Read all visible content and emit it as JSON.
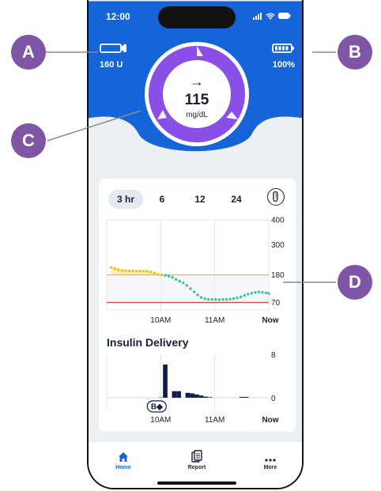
{
  "colors": {
    "brand_blue": "#1565d8",
    "ring_purple": "#8a4fe6",
    "callout_purple": "#7f56a6",
    "target_line": "#f2b124",
    "low_line": "#e0443a",
    "high_dots": "#f2c100",
    "in_range_dots": "#3ec39a",
    "bar": "#0c1f4f"
  },
  "status_bar": {
    "time": "12:00"
  },
  "pod": {
    "insulin_label": "160 U",
    "icon": "insulin-pod-icon"
  },
  "battery": {
    "label": "100%",
    "icon": "battery-icon"
  },
  "glucose": {
    "trend_arrow": "→",
    "value": "115",
    "unit": "mg/dL"
  },
  "time_tabs": [
    {
      "label": "3 hr",
      "selected": true
    },
    {
      "label": "6"
    },
    {
      "label": "12"
    },
    {
      "label": "24"
    }
  ],
  "cgm_chart": {
    "y_ticks": [
      "400",
      "300",
      "180",
      "70"
    ],
    "x_ticks": [
      "10AM",
      "11AM",
      "Now"
    ],
    "high_target": 180,
    "low_limit": 70
  },
  "insulin_delivery": {
    "title": "Insulin Delivery",
    "y_ticks": [
      "8",
      "0"
    ],
    "x_ticks": [
      "10AM",
      "11AM",
      "Now"
    ],
    "bolus_badge": "B◆"
  },
  "bottom_nav": [
    {
      "label": "Home",
      "icon": "home-icon"
    },
    {
      "label": "Report",
      "icon": "report-icon"
    },
    {
      "label": "More",
      "icon": "more-icon"
    }
  ],
  "callouts": [
    "A",
    "B",
    "C",
    "D"
  ],
  "chart_data": [
    {
      "type": "scatter",
      "title": "",
      "x": [
        "09:05",
        "09:09",
        "09:13",
        "09:17",
        "09:21",
        "09:25",
        "09:29",
        "09:33",
        "09:37",
        "09:41",
        "09:45",
        "09:49",
        "09:53",
        "09:57",
        "10:01",
        "10:05",
        "10:09",
        "10:13",
        "10:17",
        "10:21",
        "10:25",
        "10:29",
        "10:33",
        "10:37",
        "10:41",
        "10:45",
        "10:49",
        "10:53",
        "10:57",
        "11:01",
        "11:05",
        "11:09",
        "11:13",
        "11:17",
        "11:21",
        "11:25",
        "11:29",
        "11:33",
        "11:37",
        "11:41",
        "11:45",
        "11:49",
        "11:53",
        "11:57",
        "12:00"
      ],
      "y": [
        210,
        205,
        200,
        198,
        197,
        196,
        196,
        195,
        196,
        195,
        195,
        192,
        188,
        182,
        180,
        178,
        175,
        170,
        162,
        155,
        148,
        138,
        125,
        112,
        100,
        90,
        85,
        82,
        82,
        82,
        81,
        82,
        82,
        83,
        85,
        88,
        92,
        98,
        103,
        107,
        110,
        112,
        110,
        108,
        106
      ],
      "xlabel": "",
      "ylabel": "",
      "x_ticks": [
        "10AM",
        "11AM",
        "Now"
      ],
      "ylim": [
        40,
        400
      ],
      "y_ticks": [
        400,
        300,
        180,
        70
      ],
      "reference_lines": [
        180,
        70
      ],
      "grid": true
    },
    {
      "type": "bar",
      "title": "Insulin Delivery",
      "x": [
        "09:55",
        "10:00",
        "10:05",
        "10:10",
        "10:15",
        "10:20",
        "10:25",
        "10:30",
        "10:35",
        "10:40",
        "10:45",
        "10:50",
        "10:55",
        "11:00",
        "11:05",
        "11:10",
        "11:15",
        "11:20",
        "11:25",
        "11:30",
        "11:35",
        "11:40",
        "11:45"
      ],
      "values": [
        0,
        0.05,
        6.1,
        0,
        1.2,
        1.2,
        0,
        0.9,
        0.8,
        0.6,
        0.4,
        0.2,
        0.1,
        0,
        0,
        0,
        0,
        0,
        0,
        0.15,
        0.15,
        0,
        0
      ],
      "x_ticks": [
        "10AM",
        "11AM",
        "Now"
      ],
      "ylim": [
        0,
        8
      ],
      "y_ticks": [
        8,
        0
      ],
      "grid": true
    }
  ]
}
